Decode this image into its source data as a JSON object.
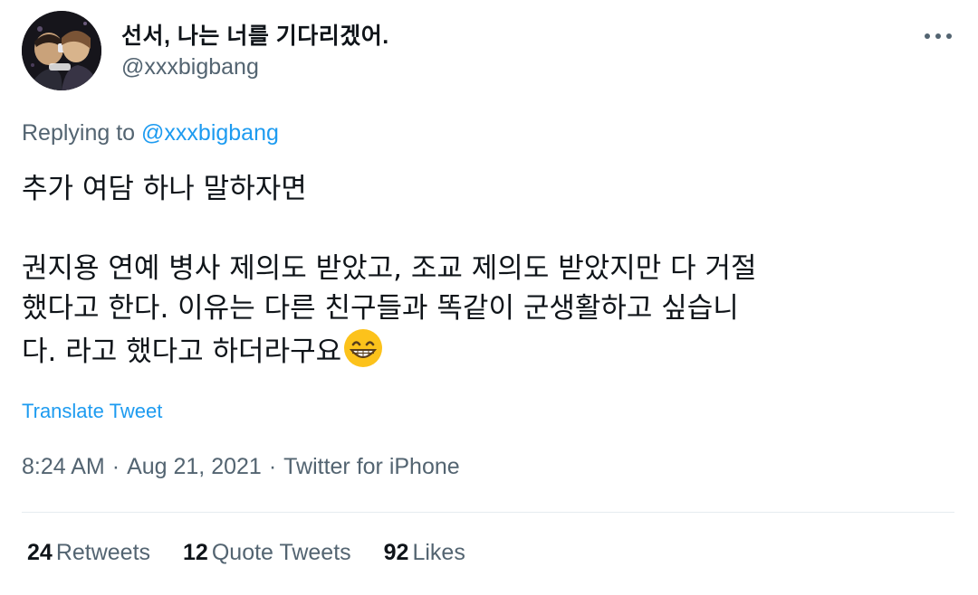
{
  "tweet": {
    "author": {
      "display_name": "선서, 나는 너를 기다리겠어.",
      "handle": "@xxxbigbang"
    },
    "more_icon": "more-horizontal-icon",
    "replying_prefix": "Replying to",
    "replying_handle": "@xxxbigbang",
    "body_lines": [
      "추가 여담 하나 말하자면",
      "권지용 연예 병사 제의도 받았고, 조교 제의도 받았지만 다 거절",
      "했다고 한다. 이유는 다른 친구들과 똑같이 군생활하고 싶습니",
      "다. 라고 했다고 하더라구요"
    ],
    "emoji": "grinning-face-with-smiling-eyes",
    "translate_label": "Translate Tweet",
    "time": "8:24 AM",
    "date": "Aug 21, 2021",
    "source": "Twitter for iPhone",
    "separator": "·",
    "stats": {
      "retweets_count": "24",
      "retweets_label": "Retweets",
      "quotes_count": "12",
      "quotes_label": "Quote Tweets",
      "likes_count": "92",
      "likes_label": "Likes"
    },
    "colors": {
      "link": "#1d9bf0",
      "secondary_text": "#536471",
      "primary_text": "#0f1419",
      "divider": "#e6ecf0"
    }
  }
}
